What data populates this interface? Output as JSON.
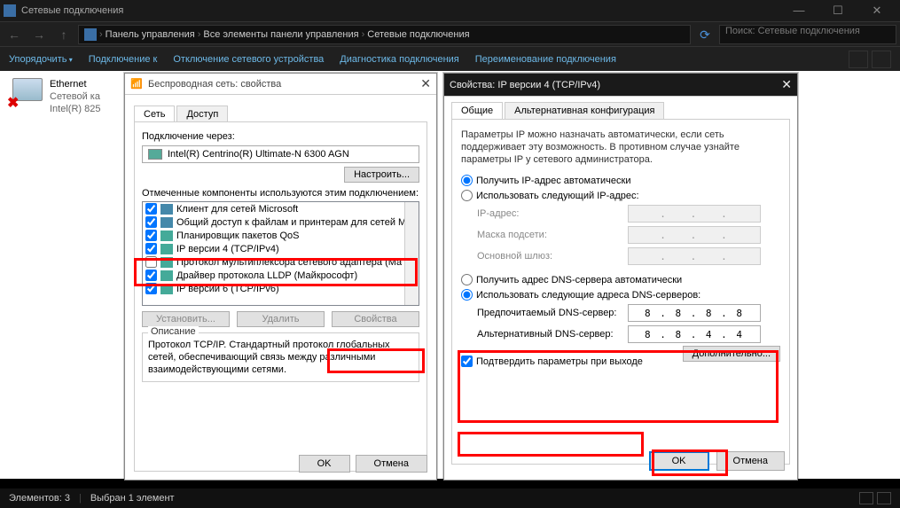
{
  "mainWindow": {
    "title": "Сетевые подключения",
    "breadcrumb": [
      "Панель управления",
      "Все элементы панели управления",
      "Сетевые подключения"
    ],
    "searchPlaceholder": "Поиск: Сетевые подключения",
    "toolbar": {
      "organize": "Упорядочить",
      "actions": [
        "Подключение к",
        "Отключение сетевого устройства",
        "Диагностика подключения",
        "Переименование подключения"
      ]
    },
    "adapter": {
      "name": "Ethernet",
      "status": "Сетевой ка",
      "device": "Intel(R) 825"
    }
  },
  "dlg1": {
    "title": "Беспроводная сеть: свойства",
    "tabs": [
      "Сеть",
      "Доступ"
    ],
    "connViaLabel": "Подключение через:",
    "adapterName": "Intel(R) Centrino(R) Ultimate-N 6300 AGN",
    "configureBtn": "Настроить...",
    "componentsLabel": "Отмеченные компоненты используются этим подключением:",
    "components": [
      {
        "checked": true,
        "label": "Клиент для сетей Microsoft",
        "iconClass": "blue"
      },
      {
        "checked": true,
        "label": "Общий доступ к файлам и принтерам для сетей Mi",
        "iconClass": "blue"
      },
      {
        "checked": true,
        "label": "Планировщик пакетов QoS",
        "iconClass": ""
      },
      {
        "checked": true,
        "label": "IP версии 4 (TCP/IPv4)",
        "iconClass": ""
      },
      {
        "checked": false,
        "label": "Протокол мультиплексора сетевого адаптера (Ма",
        "iconClass": ""
      },
      {
        "checked": true,
        "label": "Драйвер протокола LLDP (Майкрософт)",
        "iconClass": ""
      },
      {
        "checked": true,
        "label": "IP версии 6 (TCP/IPv6)",
        "iconClass": ""
      }
    ],
    "installBtn": "Установить...",
    "removeBtn": "Удалить",
    "propsBtn": "Свойства",
    "descLabel": "Описание",
    "descText": "Протокол TCP/IP. Стандартный протокол глобальных сетей, обеспечивающий связь между различными взаимодействующими сетями.",
    "okBtn": "OK",
    "cancelBtn": "Отмена"
  },
  "dlg2": {
    "title": "Свойства: IP версии 4 (TCP/IPv4)",
    "tabs": [
      "Общие",
      "Альтернативная конфигурация"
    ],
    "infoText": "Параметры IP можно назначать автоматически, если сеть поддерживает эту возможность. В противном случае узнайте параметры IP у сетевого администратора.",
    "ipAutoLabel": "Получить IP-адрес автоматически",
    "ipManualLabel": "Использовать следующий IP-адрес:",
    "ipFields": {
      "ipLabel": "IP-адрес:",
      "maskLabel": "Маска подсети:",
      "gwLabel": "Основной шлюз:"
    },
    "dnsAutoLabel": "Получить адрес DNS-сервера автоматически",
    "dnsManualLabel": "Использовать следующие адреса DNS-серверов:",
    "dnsFields": {
      "prefLabel": "Предпочитаемый DNS-сервер:",
      "prefValue": "8 . 8 . 8 . 8",
      "altLabel": "Альтернативный DNS-сервер:",
      "altValue": "8 . 8 . 4 . 4"
    },
    "validateLabel": "Подтвердить параметры при выходе",
    "advBtn": "Дополнительно...",
    "okBtn": "OK",
    "cancelBtn": "Отмена"
  },
  "statusbar": {
    "elements": "Элементов: 3",
    "selected": "Выбран 1 элемент"
  }
}
